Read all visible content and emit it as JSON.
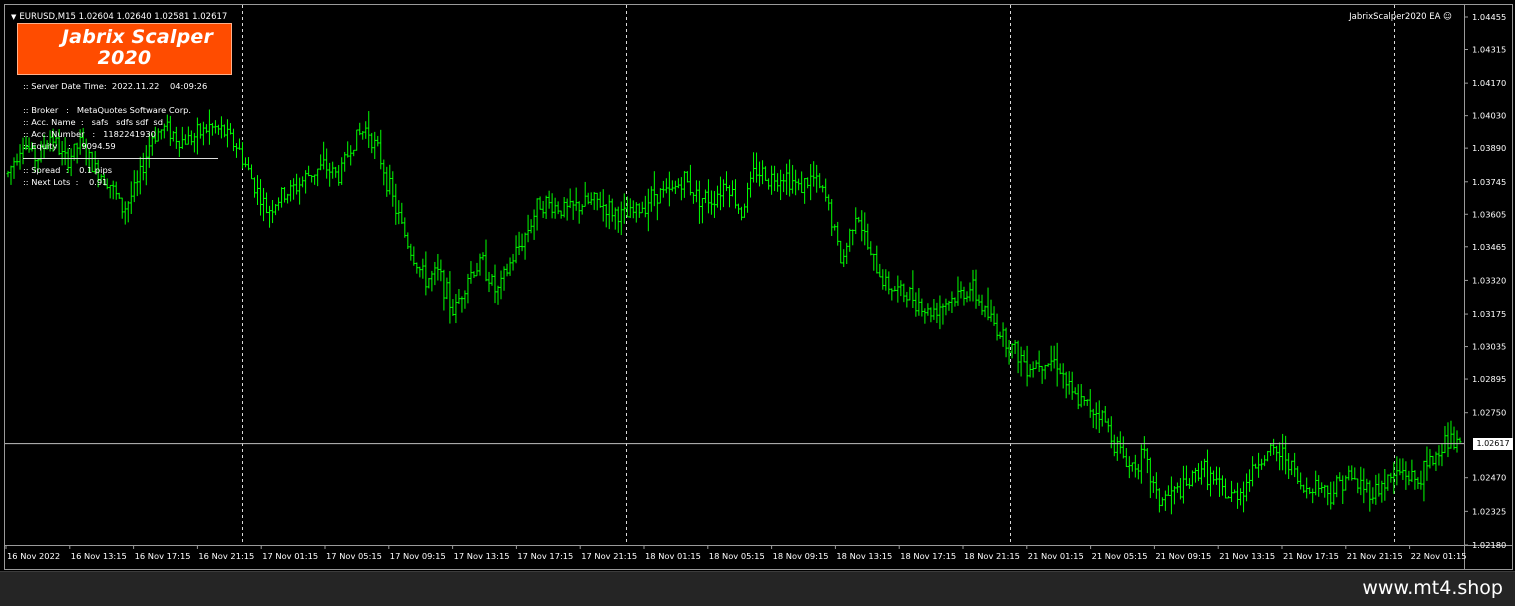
{
  "chart": {
    "symbol_line": "EURUSD,M15  1.02604 1.02640 1.02581 1.02617",
    "ea_label": "JabrixScalper2020 EA ☺",
    "current_price": "1.02617",
    "colors": {
      "background": "#000000",
      "bars": "#00ff00",
      "grid": "#ffffff",
      "bid_line": "#c0c0c0"
    }
  },
  "logo": {
    "line1": "Jabrix Scalper",
    "line2": "2020",
    "color": "#ff4c00"
  },
  "info": {
    "server": ":: Server Date Time:  2022.11.22    04:09:26",
    "broker": ":: Broker   :   MetaQuotes Software Corp.",
    "acc_name": ":: Acc. Name  :   safs   sdfs sdf  sd",
    "acc_number": ":: Acc. Number   :   1182241930",
    "equity": ":: Equity    :    9094.59",
    "spread": ":: Spread  :    0.1 pips",
    "next_lots": ":: Next Lots  :    0.91"
  },
  "footer": {
    "site": "www.mt4.shop"
  },
  "chart_data": {
    "type": "candlestick",
    "symbol": "EURUSD",
    "timeframe": "M15",
    "ylim": [
      1.0218,
      1.04455
    ],
    "y_ticks": [
      "1.04455",
      "1.04315",
      "1.04170",
      "1.04030",
      "1.03890",
      "1.03745",
      "1.03605",
      "1.03465",
      "1.03320",
      "1.03175",
      "1.03035",
      "1.02895",
      "1.02750",
      "1.02617",
      "1.02470",
      "1.02325",
      "1.02180"
    ],
    "x_ticks": [
      "16 Nov 2022",
      "16 Nov 13:15",
      "16 Nov 17:15",
      "16 Nov 21:15",
      "17 Nov 01:15",
      "17 Nov 05:15",
      "17 Nov 09:15",
      "17 Nov 13:15",
      "17 Nov 17:15",
      "17 Nov 21:15",
      "18 Nov 01:15",
      "18 Nov 05:15",
      "18 Nov 09:15",
      "18 Nov 13:15",
      "18 Nov 17:15",
      "18 Nov 21:15",
      "21 Nov 01:15",
      "21 Nov 05:15",
      "21 Nov 09:15",
      "21 Nov 13:15",
      "21 Nov 17:15",
      "21 Nov 21:15",
      "22 Nov 01:15"
    ],
    "day_separators": [
      "17 Nov 2022",
      "18 Nov 2022",
      "21 Nov 2022",
      "22 Nov 2022"
    ],
    "grid": false,
    "price_path": [
      [
        "16 Nov 10:00",
        1.0378
      ],
      [
        "16 Nov 11:00",
        1.0392
      ],
      [
        "16 Nov 12:00",
        1.0384
      ],
      [
        "16 Nov 13:00",
        1.0395
      ],
      [
        "16 Nov 14:00",
        1.0383
      ],
      [
        "16 Nov 15:00",
        1.0391
      ],
      [
        "16 Nov 16:00",
        1.038
      ],
      [
        "16 Nov 17:00",
        1.0375
      ],
      [
        "16 Nov 18:00",
        1.0362
      ],
      [
        "16 Nov 19:00",
        1.0373
      ],
      [
        "16 Nov 20:00",
        1.0394
      ],
      [
        "16 Nov 21:00",
        1.0398
      ],
      [
        "16 Nov 22:00",
        1.0392
      ],
      [
        "16 Nov 23:00",
        1.0394
      ],
      [
        "17 Nov 00:00",
        1.0398
      ],
      [
        "17 Nov 01:00",
        1.0396
      ],
      [
        "17 Nov 02:00",
        1.0389
      ],
      [
        "17 Nov 03:00",
        1.0375
      ],
      [
        "17 Nov 04:00",
        1.0362
      ],
      [
        "17 Nov 05:00",
        1.0368
      ],
      [
        "17 Nov 06:00",
        1.0372
      ],
      [
        "17 Nov 07:00",
        1.0378
      ],
      [
        "17 Nov 08:00",
        1.0381
      ],
      [
        "17 Nov 09:00",
        1.0377
      ],
      [
        "17 Nov 10:00",
        1.0392
      ],
      [
        "17 Nov 11:00",
        1.0398
      ],
      [
        "17 Nov 12:00",
        1.0383
      ],
      [
        "17 Nov 13:00",
        1.0362
      ],
      [
        "17 Nov 14:00",
        1.0345
      ],
      [
        "17 Nov 15:00",
        1.0332
      ],
      [
        "17 Nov 16:00",
        1.0335
      ],
      [
        "17 Nov 17:00",
        1.0318
      ],
      [
        "17 Nov 18:00",
        1.0334
      ],
      [
        "17 Nov 19:00",
        1.034
      ],
      [
        "17 Nov 20:00",
        1.0326
      ],
      [
        "17 Nov 21:00",
        1.034
      ],
      [
        "17 Nov 22:00",
        1.0352
      ],
      [
        "17 Nov 23:00",
        1.0366
      ],
      [
        "18 Nov 00:00",
        1.0364
      ],
      [
        "18 Nov 01:00",
        1.0362
      ],
      [
        "18 Nov 02:00",
        1.0365
      ],
      [
        "18 Nov 03:00",
        1.0366
      ],
      [
        "18 Nov 04:00",
        1.0362
      ],
      [
        "18 Nov 05:00",
        1.0359
      ],
      [
        "18 Nov 06:00",
        1.0363
      ],
      [
        "18 Nov 07:00",
        1.037
      ],
      [
        "18 Nov 08:00",
        1.0369
      ],
      [
        "18 Nov 09:00",
        1.0376
      ],
      [
        "18 Nov 10:00",
        1.0368
      ],
      [
        "18 Nov 11:00",
        1.0367
      ],
      [
        "18 Nov 12:00",
        1.0375
      ],
      [
        "18 Nov 13:00",
        1.0361
      ],
      [
        "18 Nov 14:00",
        1.038
      ],
      [
        "18 Nov 15:00",
        1.0376
      ],
      [
        "18 Nov 16:00",
        1.0378
      ],
      [
        "18 Nov 17:00",
        1.0372
      ],
      [
        "18 Nov 18:00",
        1.0376
      ],
      [
        "18 Nov 19:00",
        1.0366
      ],
      [
        "18 Nov 20:00",
        1.0339
      ],
      [
        "18 Nov 21:00",
        1.0363
      ],
      [
        "18 Nov 22:00",
        1.0342
      ],
      [
        "18 Nov 23:00",
        1.0331
      ],
      [
        "19 Nov 00:00",
        1.0327
      ],
      [
        "19 Nov 01:00",
        1.0325
      ],
      [
        "19 Nov 02:00",
        1.0318
      ],
      [
        "19 Nov 03:00",
        1.0322
      ],
      [
        "19 Nov 04:00",
        1.0325
      ],
      [
        "19 Nov 05:00",
        1.0329
      ],
      [
        "19 Nov 06:00",
        1.0318
      ],
      [
        "19 Nov 07:00",
        1.031
      ],
      [
        "19 Nov 08:00",
        1.0302
      ],
      [
        "19 Nov 09:00",
        1.0295
      ],
      [
        "19 Nov 10:00",
        1.0298
      ],
      [
        "19 Nov 11:00",
        1.0297
      ],
      [
        "19 Nov 12:00",
        1.0282
      ],
      [
        "19 Nov 13:00",
        1.0278
      ],
      [
        "19 Nov 14:00",
        1.0275
      ],
      [
        "19 Nov 15:00",
        1.0262
      ],
      [
        "19 Nov 16:00",
        1.0252
      ],
      [
        "19 Nov 17:00",
        1.0256
      ],
      [
        "19 Nov 18:00",
        1.0237
      ],
      [
        "19 Nov 19:00",
        1.024
      ],
      [
        "19 Nov 20:00",
        1.0243
      ],
      [
        "19 Nov 21:00",
        1.0252
      ],
      [
        "19 Nov 22:00",
        1.0244
      ],
      [
        "19 Nov 23:00",
        1.0238
      ],
      [
        "20 Nov 00:00",
        1.0243
      ],
      [
        "20 Nov 01:00",
        1.0255
      ],
      [
        "20 Nov 02:00",
        1.0258
      ],
      [
        "20 Nov 03:00",
        1.0256
      ],
      [
        "20 Nov 04:00",
        1.0241
      ],
      [
        "20 Nov 05:00",
        1.0245
      ],
      [
        "20 Nov 06:00",
        1.024
      ],
      [
        "20 Nov 07:00",
        1.0248
      ],
      [
        "20 Nov 08:00",
        1.0244
      ],
      [
        "20 Nov 09:00",
        1.0241
      ],
      [
        "20 Nov 10:00",
        1.0246
      ],
      [
        "20 Nov 11:00",
        1.025
      ],
      [
        "20 Nov 12:00",
        1.0245
      ],
      [
        "20 Nov 13:00",
        1.0254
      ],
      [
        "20 Nov 14:00",
        1.0263
      ],
      [
        "20 Nov 15:00",
        1.0261
      ]
    ]
  }
}
